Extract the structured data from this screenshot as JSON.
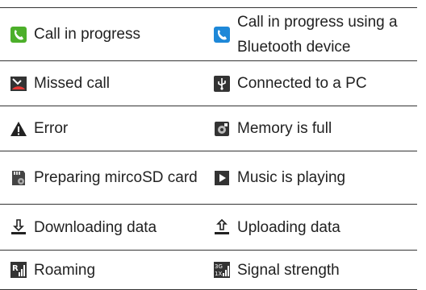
{
  "rows": [
    {
      "left": {
        "icon": "call-in-progress-icon",
        "label": "Call in progress"
      },
      "right": {
        "icon": "bluetooth-call-icon",
        "label": "Call in progress using a Bluetooth device"
      }
    },
    {
      "left": {
        "icon": "missed-call-icon",
        "label": "Missed call"
      },
      "right": {
        "icon": "usb-connected-icon",
        "label": "Connected to a PC"
      }
    },
    {
      "left": {
        "icon": "error-warning-icon",
        "label": "Error"
      },
      "right": {
        "icon": "memory-full-icon",
        "label": "Memory is full"
      }
    },
    {
      "left": {
        "icon": "sd-card-prepare-icon",
        "label": "Preparing mircoSD card"
      },
      "right": {
        "icon": "music-playing-icon",
        "label": "Music is playing"
      }
    },
    {
      "left": {
        "icon": "download-icon",
        "label": "Downloading data"
      },
      "right": {
        "icon": "upload-icon",
        "label": "Uploading data"
      }
    },
    {
      "left": {
        "icon": "roaming-icon",
        "label": "Roaming"
      },
      "right": {
        "icon": "signal-strength-icon",
        "label": "Signal strength"
      }
    }
  ],
  "colors": {
    "green_call": "#4caf2a",
    "blue_call": "#1e88d8",
    "border": "#333333"
  }
}
